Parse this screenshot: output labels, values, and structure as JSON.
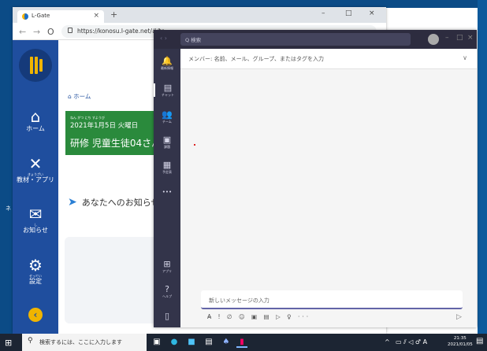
{
  "desktop": {
    "letter": "ネ"
  },
  "browser": {
    "tab_title": "L-Gate",
    "tab_close": "×",
    "new_tab": "+",
    "minimize": "–",
    "maximize": "□",
    "close": "×",
    "back": "←",
    "forward": "→",
    "reload": "O",
    "url": "https://konosu.l-gate.net/#/to"
  },
  "lgate": {
    "nav": [
      {
        "icon": "⌂",
        "ruby": "",
        "label": "ホーム"
      },
      {
        "icon": "✕",
        "ruby": "きょうざい",
        "label": "教材・アプリ"
      },
      {
        "icon": "✉",
        "ruby": "し",
        "label": "お知らせ"
      },
      {
        "icon": "⚙",
        "ruby": "せってい",
        "label": "設定"
      }
    ],
    "back_button": "‹",
    "breadcrumb": "⌂ ホーム",
    "card_ruby": "ねん がつ にち  すようび",
    "card_date": "2021年1月5日 火曜日",
    "card_name": "研修 児童生徒04さん",
    "notice_title": "あなたへのお知らせ",
    "notice_icon": "➤",
    "notice_ruby": "し"
  },
  "teams": {
    "search_placeholder": "Q 検索",
    "nav_arrows": "‹ ›",
    "win_min": "–",
    "win_max": "□",
    "win_close": "×",
    "rail": [
      {
        "icon": "🔔",
        "label": "最新情報"
      },
      {
        "icon": "▤",
        "label": "チャット"
      },
      {
        "icon": "👥",
        "label": "チーム"
      },
      {
        "icon": "▣",
        "label": "課題"
      },
      {
        "icon": "▦",
        "label": "予定表"
      },
      {
        "icon": "•••",
        "label": ""
      },
      {
        "icon": "⊞",
        "label": "アプリ"
      },
      {
        "icon": "?",
        "label": "ヘルプ"
      },
      {
        "icon": "▯",
        "label": ""
      }
    ],
    "to_line": "メンバー: 名前、メール、グループ、またはタグを入力",
    "chevron": "∨",
    "compose_placeholder": "新しいメッセージの入力",
    "format_icons": "A̶ ! ∅ ☺ ▣ ▤ ▷ ♀ ···",
    "send": "▷"
  },
  "taskbar": {
    "start": "⊞",
    "search_icon": "⚲",
    "search_placeholder": "検索するには、ここに入力します",
    "tray_chevron": "^",
    "tray_icons": "▭ ⫽ ◁ ♂ A",
    "time": "21:35",
    "date": "2021/01/05",
    "notifications": "▤"
  }
}
